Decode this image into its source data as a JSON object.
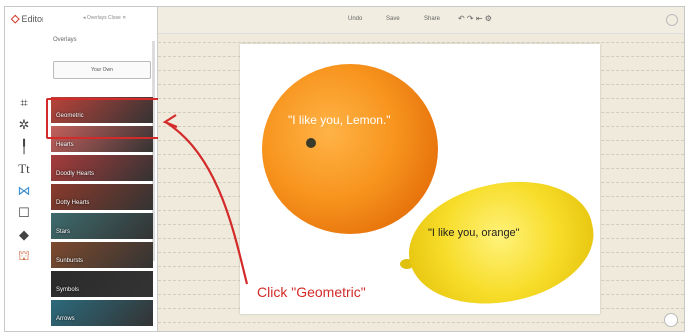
{
  "app": {
    "logo_text": "Editor"
  },
  "panel": {
    "top_text": "◂ Overlays   Close ✕",
    "title": "Overlays",
    "your_own_label": "Your Own",
    "tiles": [
      {
        "label": "Geometric",
        "color": "#b9433a"
      },
      {
        "label": "Hearts",
        "color": "#c4605c"
      },
      {
        "label": "Doodly Hearts",
        "color": "#a83b3b"
      },
      {
        "label": "Dotty Hearts",
        "color": "#8a3a2b"
      },
      {
        "label": "Stars",
        "color": "#3d6b6d"
      },
      {
        "label": "Sunbursts",
        "color": "#7d4a2e"
      },
      {
        "label": "Symbols",
        "color": "#2b2b2b"
      },
      {
        "label": "Arrows",
        "color": "#2c6a7c"
      }
    ]
  },
  "topbar": {
    "items": [
      "Undo",
      "Save",
      "Share",
      "↶  ↷  ⇤  ⚙"
    ]
  },
  "canvas": {
    "quote_orange": "\"I like you, Lemon.\"",
    "quote_lemon": "\"I like you, orange\""
  },
  "callout": "Click \"Geometric\"",
  "colors": {
    "accent": "#d32a2a"
  }
}
